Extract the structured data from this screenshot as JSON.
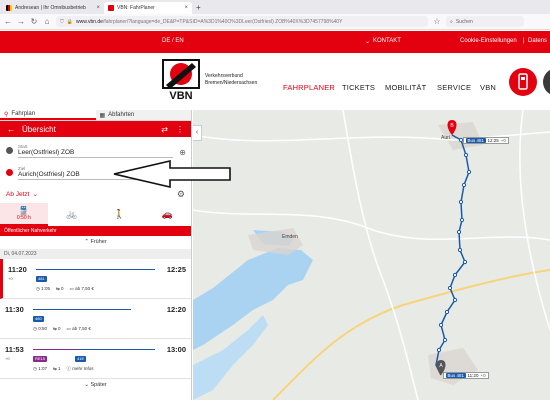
{
  "browser": {
    "tabs": [
      {
        "title": "Andresean | Ihr Omnibusbetrieb",
        "active": false
      },
      {
        "title": "VBN: FahrPlaner",
        "active": true
      }
    ],
    "url_domain": "www.vbn.de",
    "url_rest": "/fahrplaner/?language=de_DE&P=TP&SID=A%3D1%40O%3DLeer(Ostfriesl) ZOB%40X%3D7457798%40Y",
    "search_placeholder": "Suchen"
  },
  "topbar": {
    "lang": "DE / EN",
    "kontakt": "KONTAKT",
    "cookie": "Cookie-Einstellungen",
    "sep": "|",
    "datenschutz": "Datens"
  },
  "header": {
    "logo_text": "VBN",
    "org_line1": "Verkehrsverbund",
    "org_line2": "Bremen/Niedersachsen",
    "nav": [
      "FAHRPLANER",
      "TICKETS",
      "MOBILITÄT",
      "SERVICE",
      "VBN"
    ]
  },
  "panel": {
    "tabs": [
      "Fahrplan",
      "Abfahrten"
    ],
    "overview_title": "Übersicht",
    "start_label": "Start",
    "start_value": "Leer(Ostfriesl) ZOB",
    "ziel_label": "Ziel",
    "ziel_value": "Aurich(Ostfriesl) ZOB",
    "ab_jetzt": "Ab Jetzt",
    "mode_time": "0:50 h",
    "oeffentlicher": "Öffentlicher Nahverkehr",
    "frueher": "Früher",
    "date": "Di, 04.07.2023",
    "spaeter": "Später",
    "connections": [
      {
        "dep": "11:20",
        "arr": "12:25",
        "delay": "+0",
        "lines": [
          "481"
        ],
        "duration": "1:05",
        "changes": "0",
        "price": "ab 7,50 €"
      },
      {
        "dep": "11:30",
        "arr": "12:20",
        "delay": "",
        "lines": [
          "460"
        ],
        "duration": "0:50",
        "changes": "0",
        "price": "ab 7,50 €"
      },
      {
        "dep": "11:53",
        "arr": "13:00",
        "delay": "+0",
        "lines": [
          "RE15",
          "41E"
        ],
        "duration": "1:07",
        "changes": "1",
        "price": "mehr Infos"
      }
    ]
  },
  "map": {
    "city_emden": "Emden",
    "city_aurich": "Auri",
    "badge_top": {
      "line": "Bus 481",
      "time": "12:25",
      "delay": "+0"
    },
    "badge_bottom": {
      "line": "Bus 481",
      "time": "11:20",
      "delay": "+0"
    },
    "marker_a": "A",
    "marker_b": "B"
  },
  "colors": {
    "brand_red": "#e3000f",
    "line_blue": "#1b5aa8",
    "rail_purple": "#8b2a8b"
  }
}
